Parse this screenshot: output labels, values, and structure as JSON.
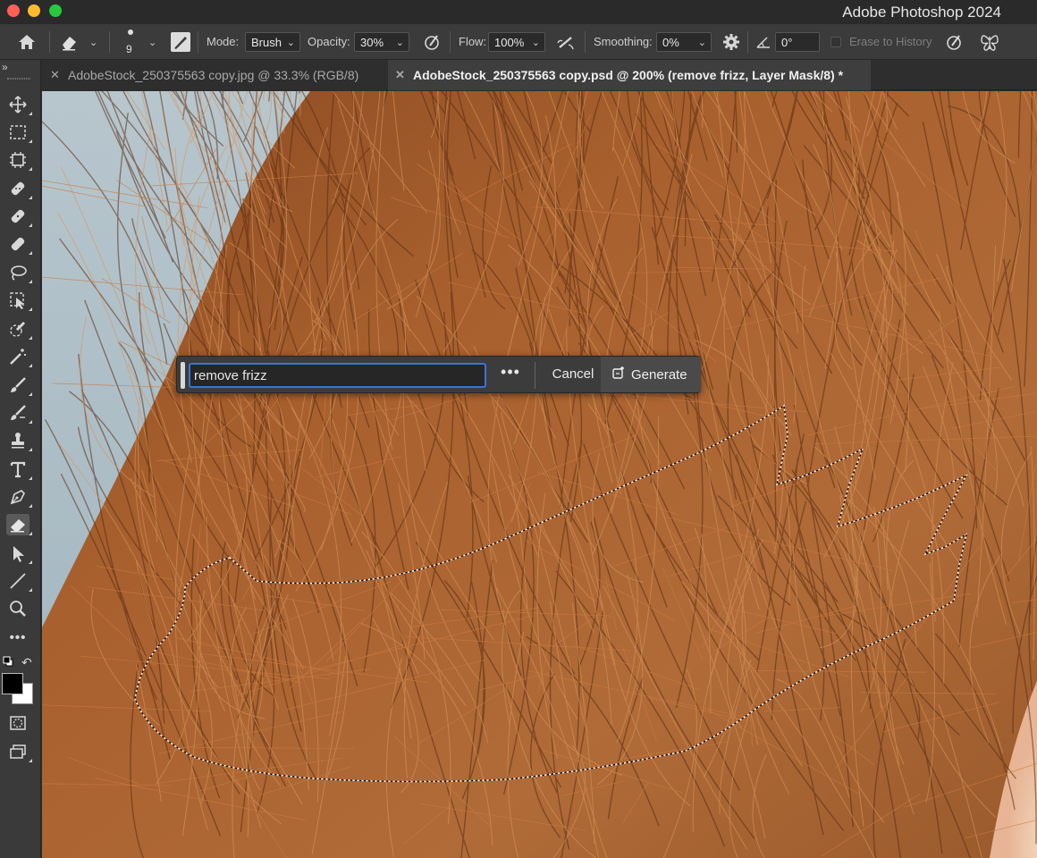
{
  "window": {
    "title": "Adobe Photoshop 2024"
  },
  "options_bar": {
    "brush_size": "9",
    "mode_label": "Mode:",
    "mode_value": "Brush",
    "opacity_label": "Opacity:",
    "opacity_value": "30%",
    "flow_label": "Flow:",
    "flow_value": "100%",
    "smoothing_label": "Smoothing:",
    "smoothing_value": "0%",
    "angle_value": "0°",
    "erase_to_history_label": "Erase to History"
  },
  "tabs": [
    {
      "label": "AdobeStock_250375563 copy.jpg @ 33.3% (RGB/8)",
      "active": false
    },
    {
      "label": "AdobeStock_250375563 copy.psd @ 200% (remove frizz, Layer Mask/8) *",
      "active": true
    }
  ],
  "generative_bar": {
    "prompt_value": "remove frizz",
    "more_label": "•••",
    "cancel_label": "Cancel",
    "generate_label": "Generate"
  },
  "tools": [
    "move-tool-icon",
    "marquee-tool-icon",
    "artboard-tool-icon",
    "spot-healing-icon",
    "healing-brush-icon",
    "patch-icon",
    "lasso-icon",
    "object-selection-icon",
    "quick-selection-icon",
    "magic-wand-icon",
    "brush-icon",
    "mixer-brush-icon",
    "clone-stamp-icon",
    "type-tool-icon",
    "pen-tool-icon",
    "eraser-tool-icon",
    "path-selection-icon",
    "line-tool-icon",
    "zoom-tool-icon",
    "more-tools-icon"
  ],
  "colors": {
    "accent": "#3b73d9",
    "foreground": "#000000",
    "background": "#ffffff",
    "hair": "#b07040",
    "sky": "#aebfc8"
  }
}
